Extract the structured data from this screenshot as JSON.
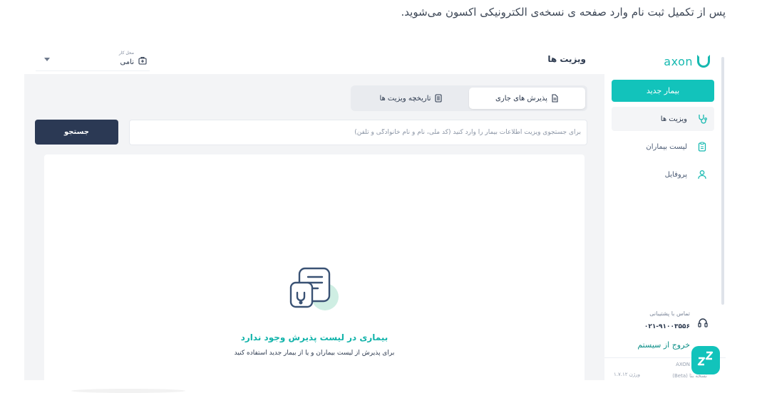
{
  "intro_text": "پس از تکمیل ثبت نام وارد صفحه ی نسخه‌ی الکترونیکی اکسون می‌شوید.",
  "brand": {
    "logo_text": "axon",
    "color": "#16b9b0"
  },
  "sidebar": {
    "new_patient_label": "بیمار جدید",
    "items": [
      {
        "label": "ویزیت ها",
        "icon": "stethoscope-icon",
        "active": true
      },
      {
        "label": "لیست بیماران",
        "icon": "clipboard-icon",
        "active": false
      },
      {
        "label": "پروفایل",
        "icon": "user-icon",
        "active": false
      }
    ],
    "support": {
      "label": "تماس با پشتیبانی",
      "phone": "۰۲۱-۹۱۰۰۳۵۵۶",
      "icon": "headset-icon"
    },
    "logout_label": "خروج از سیستم",
    "footer": {
      "brand": "AXON",
      "beta": "نسخه بتا (Beta)",
      "version": "ورژن ۱.۷.۱۲"
    }
  },
  "header": {
    "title": "ویزیت ها",
    "workplace": {
      "caption": "محل کار",
      "value": "نامی",
      "icon": "medical-bag-icon"
    }
  },
  "tabs": [
    {
      "label": "پذیرش های جاری",
      "icon": "document-icon",
      "active": true
    },
    {
      "label": "تاریخچه ویزیت ها",
      "icon": "list-icon",
      "active": false
    }
  ],
  "search": {
    "placeholder": "برای جستجوی ویزیت اطلاعات بیمار را وارد کنید (کد ملی، نام و نام خانوادگی و تلفن)",
    "value": "",
    "button_label": "جستجو"
  },
  "empty_state": {
    "title": "بیماری در لیست پذیرش وجود ندارد",
    "subtitle": "برای پذیرش از لیست بیماران و یا از بیمار جدید استفاده کنید",
    "icon": "clipboard-stethoscope-icon"
  },
  "fab_icon": "zzz-icon",
  "colors": {
    "accent": "#12c3bb",
    "dark": "#2b3954",
    "background": "#f3f4f6"
  }
}
